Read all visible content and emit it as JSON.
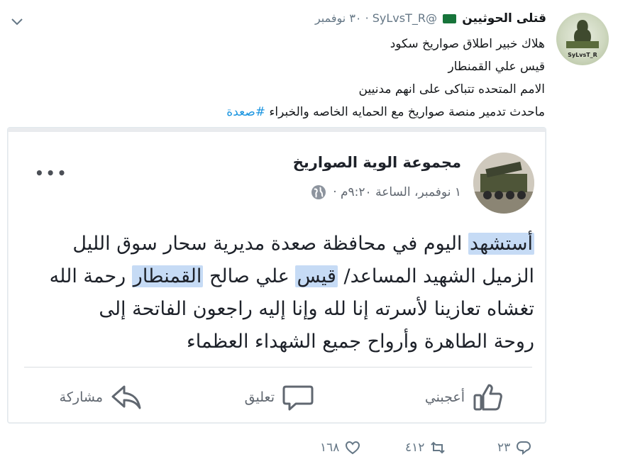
{
  "tweet": {
    "author_name": "قتلى الحوثيين",
    "handle": "@SyLvsT_R",
    "time": "٣٠ نوفمبر",
    "lines": [
      "هلاك خبير اطلاق صواريخ سكود",
      "قيس علي القمنطار",
      "الامم المتحده تتباكى على انهم مدنيين",
      "ماحدث تدمير منصة صواريخ مع الحمايه الخاصه والخبراء"
    ],
    "hashtag": "#صعدة",
    "avatar_text": "SyLvsT_R"
  },
  "card": {
    "page_name": "مجموعة الوية الصواريخ",
    "meta": "١ نوفمبر، الساعة ٩:٢٠م ·",
    "more": "•••",
    "post": {
      "line1": {
        "hl": "أستشهد",
        "rest": " اليوم في محافظة صعدة مديرية سحار سوق الليل"
      },
      "line2": {
        "a": "الزميل الشهيد المساعد/ ",
        "hl1": "قيس",
        "b": " علي صالح ",
        "hl2": "القمنطار",
        "c": " رحمة الله"
      },
      "line3": "تغشاه تعازينا لأسرته إنا لله وإنا إليه راجعون الفاتحة إلى",
      "line4": "روحة الطاهرة وأرواح جميع الشهداء العظماء"
    },
    "actions": {
      "like": "أعجبني",
      "comment": "تعليق",
      "share": "مشاركة"
    }
  },
  "stats": {
    "replies": "٢٣",
    "retweets": "٤١٢",
    "likes": "١٦٨"
  },
  "colors": {
    "hashtag": "#1b95e0",
    "highlight": "#c6dbf5",
    "muted": "#657786"
  },
  "icons": [
    "chevron-down-icon",
    "flag-icon",
    "globe-icon",
    "like-icon",
    "comment-icon",
    "share-icon",
    "reply-icon",
    "retweet-icon",
    "heart-icon"
  ]
}
